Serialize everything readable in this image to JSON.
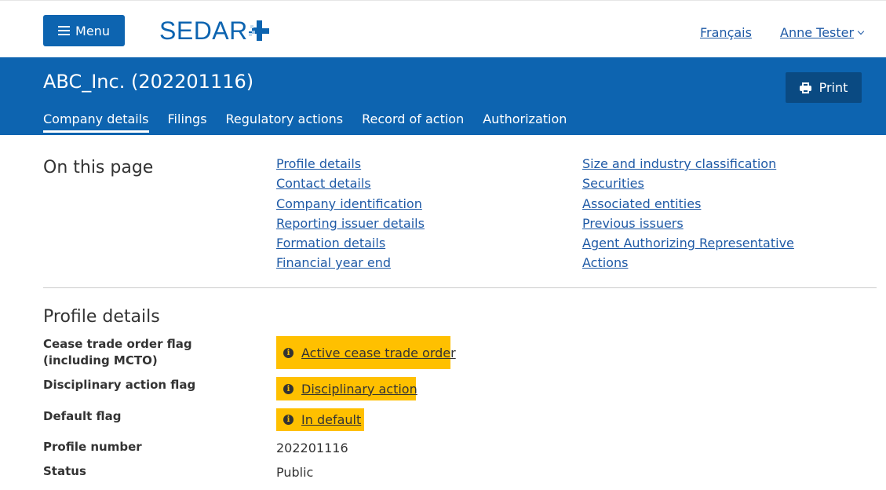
{
  "header": {
    "menu_label": "Menu",
    "logo_text": "SEDAR",
    "language_link": "Français",
    "user_name": "Anne Tester"
  },
  "banner": {
    "company_title": "ABC_Inc. (202201116)",
    "print_label": "Print",
    "tabs": [
      {
        "label": "Company details",
        "active": true
      },
      {
        "label": "Filings",
        "active": false
      },
      {
        "label": "Regulatory actions",
        "active": false
      },
      {
        "label": "Record of action",
        "active": false
      },
      {
        "label": "Authorization",
        "active": false
      }
    ]
  },
  "on_this_page": {
    "heading": "On this page",
    "column1": [
      "Profile details",
      "Contact details",
      "Company identification",
      "Reporting issuer details",
      "Formation details",
      "Financial year end"
    ],
    "column2": [
      "Size and industry classification",
      "Securities",
      "Associated entities",
      "Previous issuers",
      "Agent Authorizing Representative",
      "Actions"
    ]
  },
  "profile": {
    "title": "Profile details",
    "cto_label": "Cease trade order flag (including MCTO)",
    "cto_flag": "Active cease trade order",
    "disciplinary_label": "Disciplinary action flag",
    "disciplinary_flag": "Disciplinary action",
    "default_label": "Default flag",
    "default_flag": "In default",
    "profile_number_label": "Profile number",
    "profile_number": "202201116",
    "status_label": "Status",
    "status": "Public"
  },
  "colors": {
    "brand_blue": "#0d64b0",
    "print_button": "#0a4a82",
    "flag_yellow": "#ffc000",
    "link_blue": "#1f5aa6"
  }
}
